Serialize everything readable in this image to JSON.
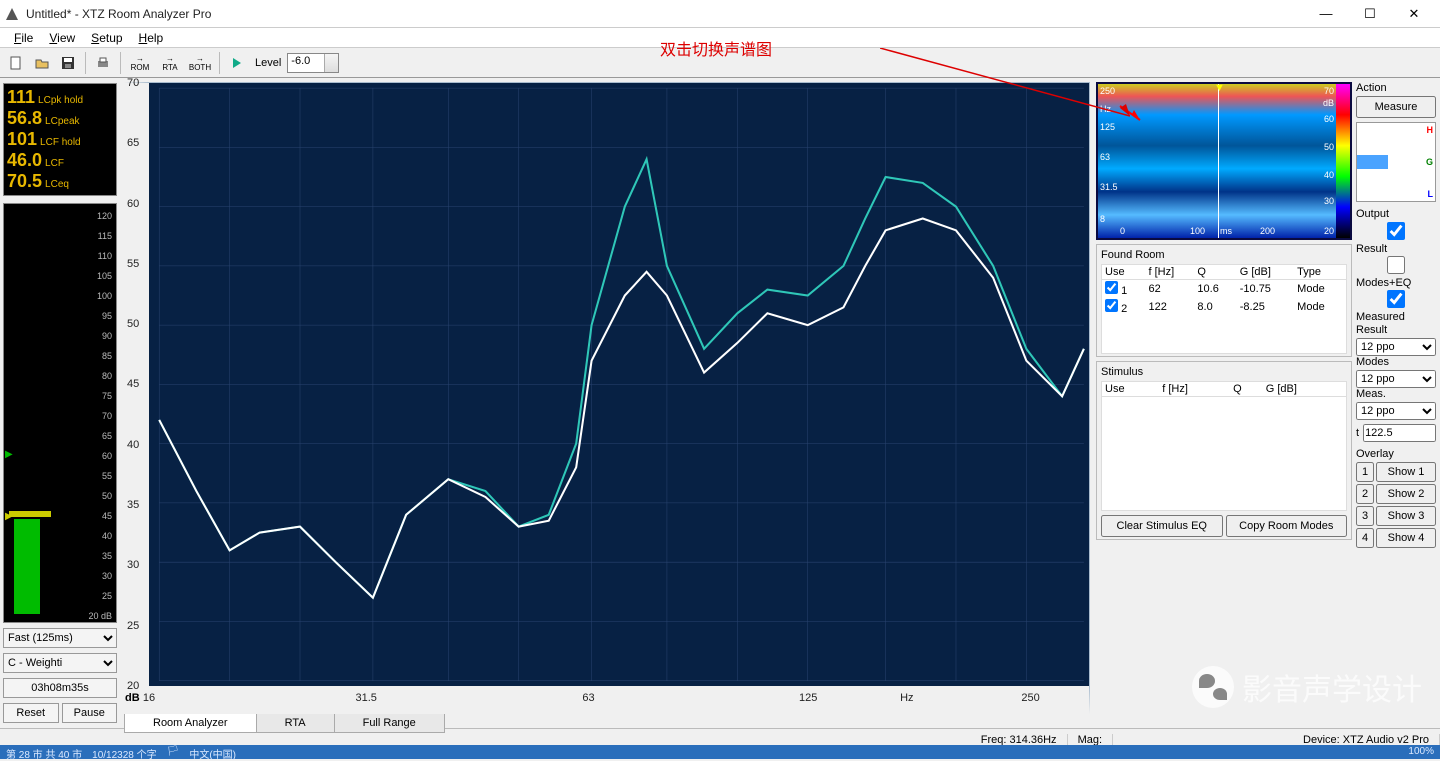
{
  "window": {
    "title": "Untitled* - XTZ Room Analyzer Pro"
  },
  "menu": {
    "file": "File",
    "view": "View",
    "setup": "Setup",
    "help": "Help"
  },
  "toolbar": {
    "rom": "ROM",
    "rta": "RTA",
    "both": "BOTH",
    "level_label": "Level",
    "level_value": "-6.0"
  },
  "meter": {
    "lcpk_hold": "111",
    "lcpk_hold_u": "LCpk hold",
    "lcpeak": "56.8",
    "lcpeak_u": "LCpeak",
    "lcf_hold": "101",
    "lcf_hold_u": "LCF hold",
    "lcf": "46.0",
    "lcf_u": "LCF",
    "lceq": "70.5",
    "lceq_u": "LCeq",
    "scale": [
      "120",
      "115",
      "110",
      "105",
      "100",
      "95",
      "90",
      "85",
      "80",
      "75",
      "70",
      "65",
      "60",
      "55",
      "50",
      "45",
      "40",
      "35",
      "30",
      "25",
      "20 dB"
    ]
  },
  "left_controls": {
    "speed": "Fast (125ms)",
    "weight": "C - Weighti",
    "clock": "03h08m35s",
    "reset": "Reset",
    "pause": "Pause"
  },
  "chart": {
    "db_label": "dB",
    "y_ticks": [
      "70",
      "65",
      "60",
      "55",
      "50",
      "45",
      "40",
      "35",
      "30",
      "25",
      "20"
    ],
    "x_ticks": [
      "16",
      "31.5",
      "63",
      "125",
      "Hz",
      "250"
    ]
  },
  "tabs": {
    "room": "Room Analyzer",
    "rta": "RTA",
    "full": "Full Range"
  },
  "spectrogram": {
    "y_ticks": [
      "250",
      "Hz",
      "125",
      "63",
      "31.5",
      "8"
    ],
    "x_ticks": [
      "0",
      "100",
      "ms",
      "200"
    ],
    "cbar": [
      "70",
      "dB",
      "60",
      "50",
      "40",
      "30",
      "20"
    ]
  },
  "found_room": {
    "title": "Found Room",
    "headers": {
      "use": "Use",
      "f": "f [Hz]",
      "q": "Q",
      "g": "G [dB]",
      "type": "Type"
    },
    "rows": [
      {
        "n": "1",
        "f": "62",
        "q": "10.6",
        "g": "-10.75",
        "type": "Mode"
      },
      {
        "n": "2",
        "f": "122",
        "q": "8.0",
        "g": "-8.25",
        "type": "Mode"
      }
    ]
  },
  "stimulus": {
    "title": "Stimulus",
    "headers": {
      "use": "Use",
      "f": "f [Hz]",
      "q": "Q",
      "g": "G [dB]"
    },
    "clear": "Clear Stimulus EQ",
    "copy": "Copy Room Modes"
  },
  "right": {
    "action": "Action",
    "measure": "Measure",
    "output": "Output",
    "chk_result": "Result",
    "chk_modes": "Modes+EQ",
    "chk_measured": "Measured",
    "result_lbl": "Result",
    "result_val": "12 ppo",
    "modes_lbl": "Modes",
    "modes_val": "12 ppo",
    "meas_lbl": "Meas.",
    "meas_val": "12 ppo",
    "t_lbl": "t",
    "t_val": "122.5",
    "overlay": "Overlay",
    "show": "Show",
    "nums": [
      "1",
      "2",
      "3",
      "4"
    ]
  },
  "status": {
    "freq_lbl": "Freq:",
    "freq": "314.36Hz",
    "mag_lbl": "Mag:",
    "device_lbl": "Device:",
    "device": "XTZ Audio v2 Pro",
    "pct": "100%"
  },
  "annotation": "双击切换声谱图",
  "watermark": "影音声学设计",
  "taskbar": {
    "l1": "第 28 市  共 40 市",
    "l2": "10/12328 个字",
    "l3": "中文(中国)"
  },
  "chart_data": {
    "type": "line",
    "xlabel": "Hz",
    "ylabel": "dB",
    "xscale": "log",
    "xlim": [
      16,
      300
    ],
    "ylim": [
      20,
      70
    ],
    "x": [
      16,
      18,
      20,
      22,
      25,
      28,
      31.5,
      35,
      40,
      45,
      50,
      55,
      60,
      63,
      70,
      75,
      80,
      90,
      100,
      110,
      125,
      140,
      150,
      160,
      180,
      200,
      225,
      250,
      280,
      300
    ],
    "series": [
      {
        "name": "Measured (teal)",
        "color": "#2fc7b8",
        "values": [
          42,
          36,
          31,
          32.5,
          33,
          30,
          27,
          34,
          37,
          36,
          33,
          34,
          40,
          50,
          60,
          64,
          55,
          48,
          51,
          53,
          52.5,
          55,
          59,
          62.5,
          62,
          60,
          55,
          48,
          44,
          48
        ]
      },
      {
        "name": "Result (white)",
        "color": "#ffffff",
        "values": [
          42,
          36,
          31,
          32.5,
          33,
          30,
          27,
          34,
          37,
          35.5,
          33,
          33.5,
          38,
          47,
          52.5,
          54.5,
          52.5,
          46,
          48.5,
          51,
          50,
          51.5,
          55,
          58,
          59,
          58,
          54,
          47,
          44,
          48
        ]
      }
    ]
  }
}
